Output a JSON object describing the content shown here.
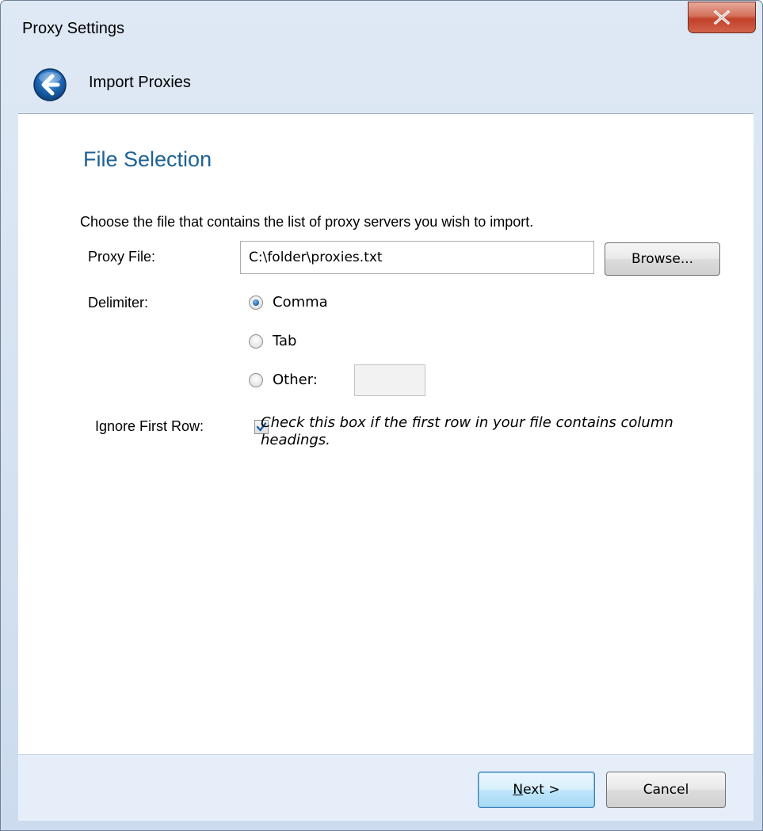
{
  "window": {
    "title": "Proxy Settings",
    "close_label": "X",
    "colors": {
      "accent": "#1d6296",
      "frame": "#d4e1f1",
      "footer": "#e6eef9",
      "close": "#c2412a"
    }
  },
  "header": {
    "back_icon": "back-arrow-icon",
    "title": "Import Proxies"
  },
  "section": {
    "title": "File Selection",
    "description": "Choose the file that contains the list of proxy servers you wish to import."
  },
  "proxy_file": {
    "label": "Proxy File:",
    "value": "C:\\folder\\proxies.txt",
    "browse_label": "Browse..."
  },
  "delimiter": {
    "label": "Delimiter:",
    "options": [
      {
        "label": "Comma",
        "checked": true
      },
      {
        "label": "Tab",
        "checked": false
      },
      {
        "label": "Other:",
        "checked": false
      }
    ],
    "other_value": ""
  },
  "ignore_first_row": {
    "label": "Ignore First Row:",
    "checked": true,
    "hint": "Check this box if the first row in your file contains column headings."
  },
  "footer": {
    "next_label": "Next >",
    "cancel_label": "Cancel"
  }
}
